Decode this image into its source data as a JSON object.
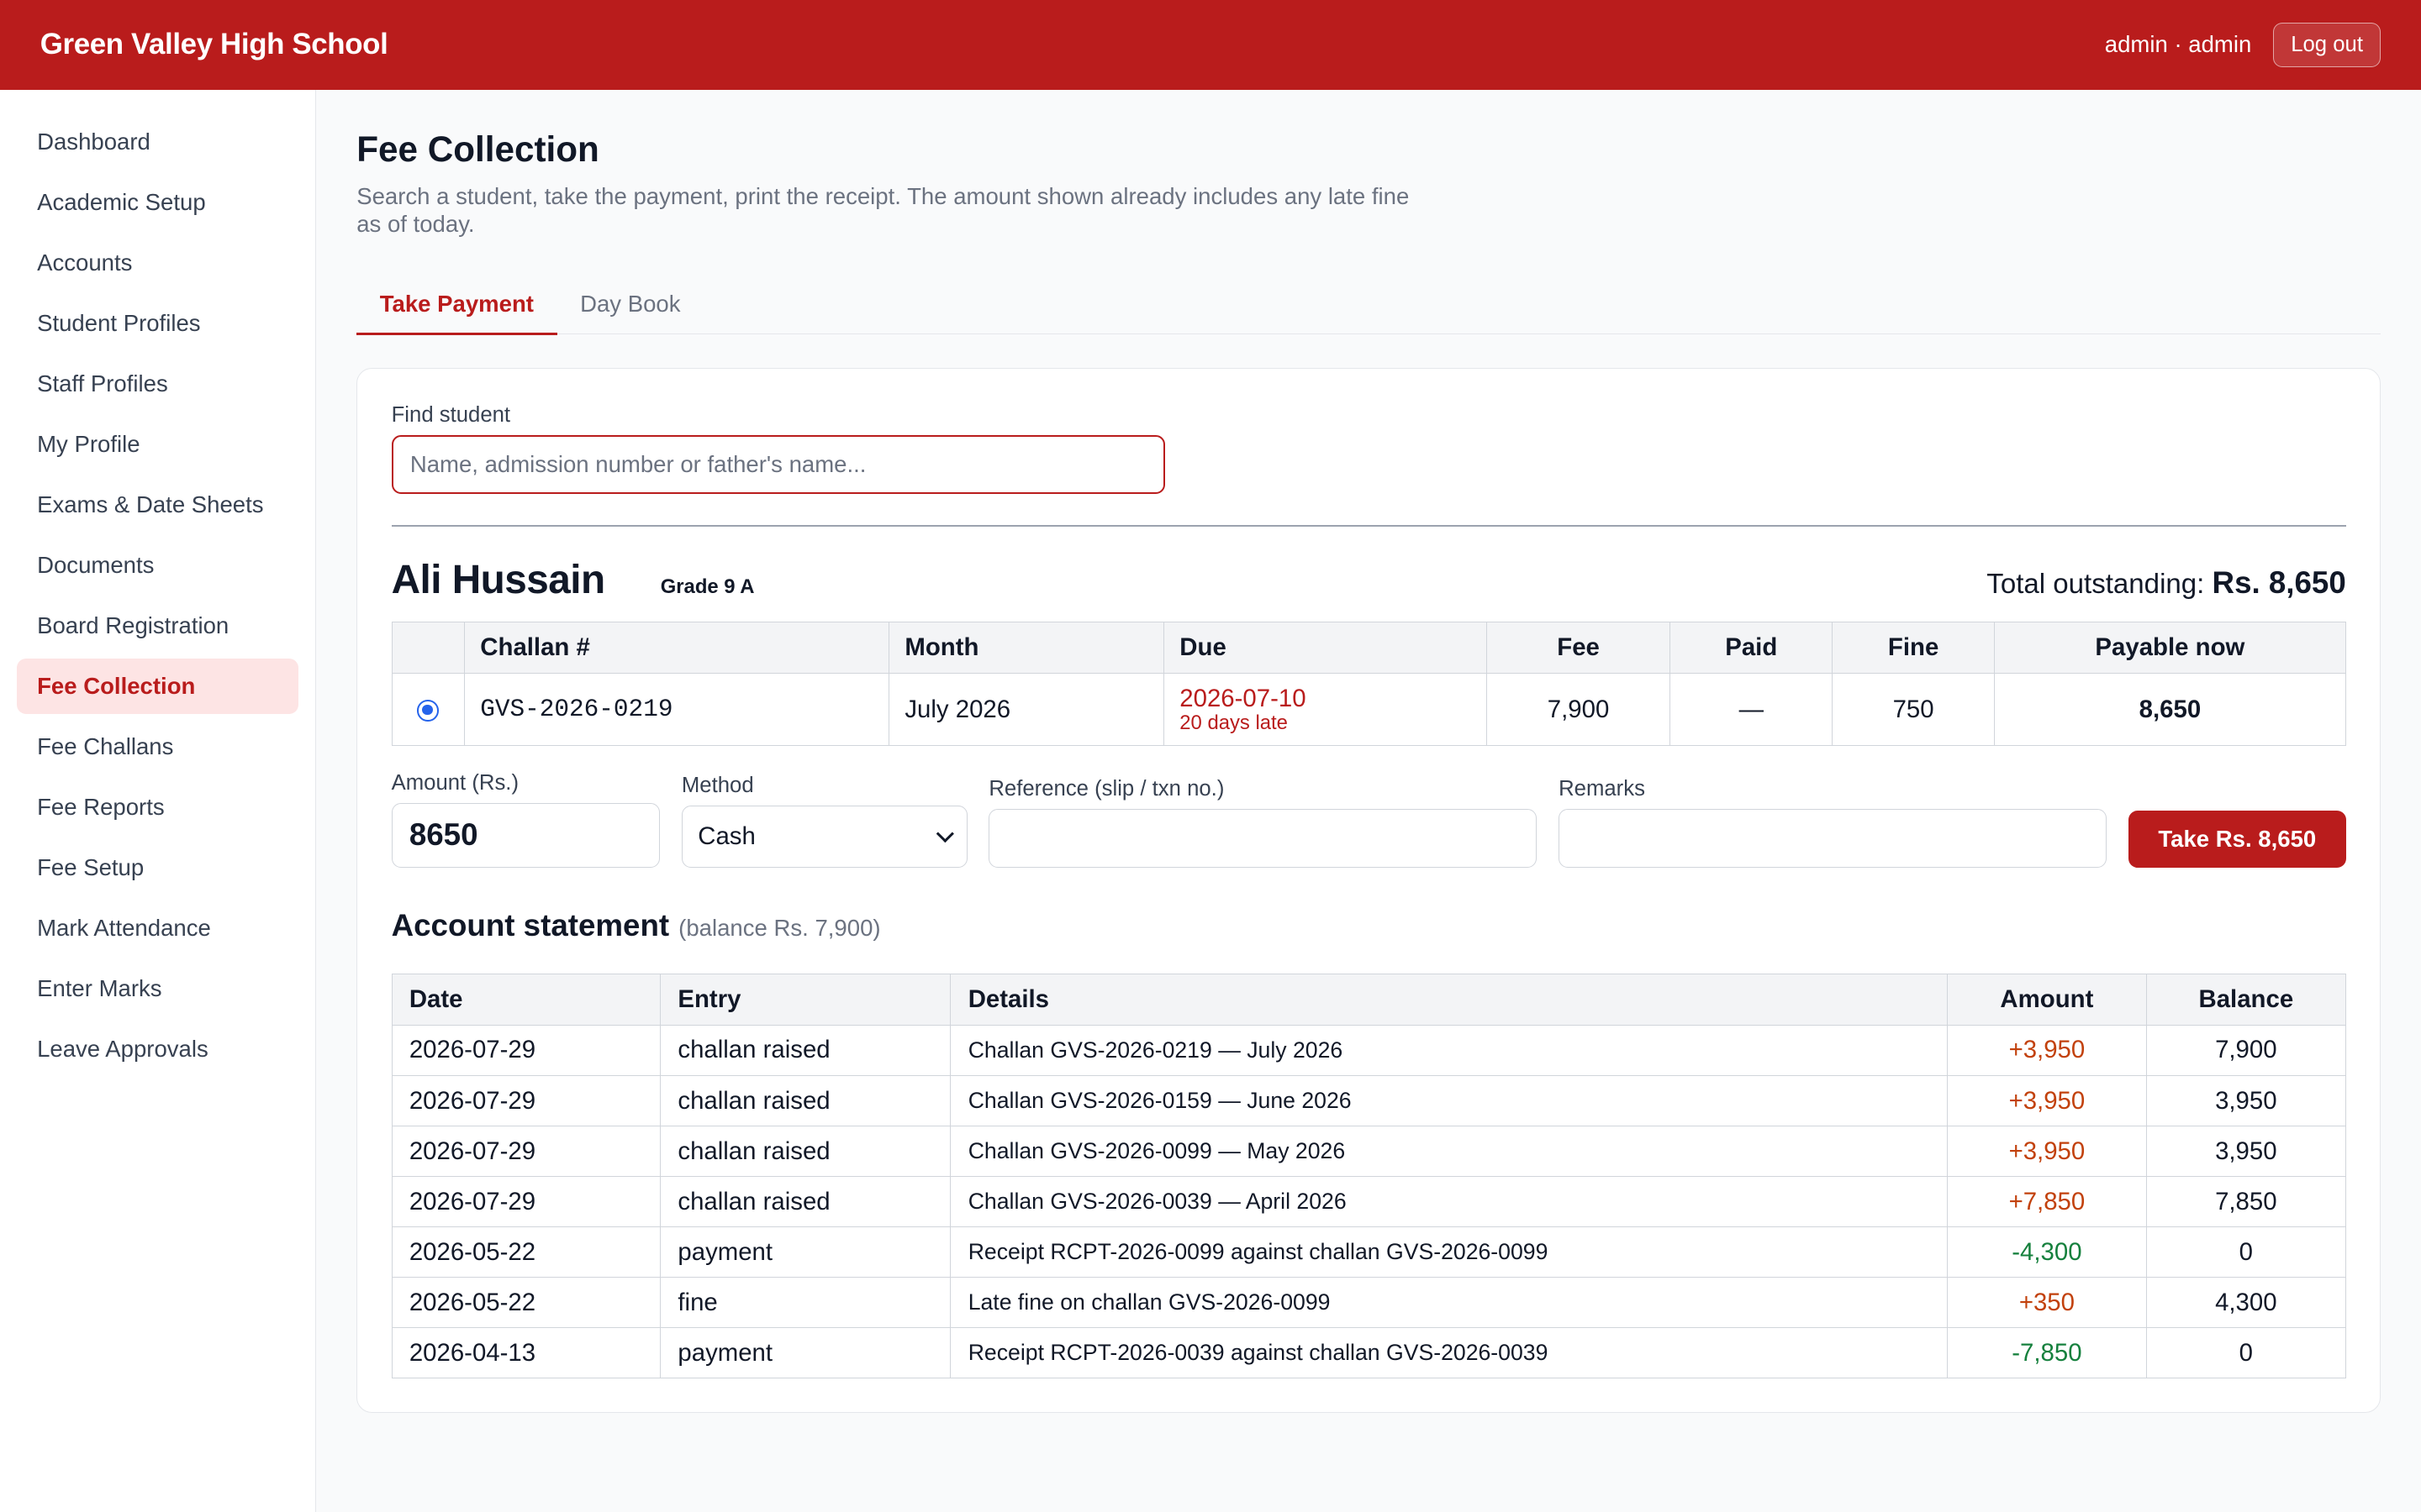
{
  "header": {
    "brand": "Green Valley High School",
    "user": "admin · admin",
    "logout_label": "Log out"
  },
  "sidebar": {
    "items": [
      {
        "label": "Dashboard",
        "active": false
      },
      {
        "label": "Academic Setup",
        "active": false
      },
      {
        "label": "Accounts",
        "active": false
      },
      {
        "label": "Student Profiles",
        "active": false
      },
      {
        "label": "Staff Profiles",
        "active": false
      },
      {
        "label": "My Profile",
        "active": false
      },
      {
        "label": "Exams & Date Sheets",
        "active": false
      },
      {
        "label": "Documents",
        "active": false
      },
      {
        "label": "Board Registration",
        "active": false
      },
      {
        "label": "Fee Collection",
        "active": true
      },
      {
        "label": "Fee Challans",
        "active": false
      },
      {
        "label": "Fee Reports",
        "active": false
      },
      {
        "label": "Fee Setup",
        "active": false
      },
      {
        "label": "Mark Attendance",
        "active": false
      },
      {
        "label": "Enter Marks",
        "active": false
      },
      {
        "label": "Leave Approvals",
        "active": false
      }
    ]
  },
  "page": {
    "title": "Fee Collection",
    "description": "Search a student, take the payment, print the receipt. The amount shown already includes any late fine as of today."
  },
  "tabs": [
    {
      "label": "Take Payment",
      "active": true
    },
    {
      "label": "Day Book",
      "active": false
    }
  ],
  "search": {
    "label": "Find student",
    "placeholder": "Name, admission number or father's name...",
    "value": ""
  },
  "student": {
    "name": "Ali Hussain",
    "grade": "Grade 9 A",
    "outstanding_label": "Total outstanding:",
    "outstanding_value": "Rs. 8,650"
  },
  "challan_table": {
    "headers": {
      "select": "",
      "challan": "Challan #",
      "month": "Month",
      "due": "Due",
      "fee": "Fee",
      "paid": "Paid",
      "fine": "Fine",
      "payable": "Payable now"
    },
    "rows": [
      {
        "selected": true,
        "challan": "GVS-2026-0219",
        "month": "July 2026",
        "due_date": "2026-07-10",
        "due_note": "20 days late",
        "fee": "7,900",
        "paid": "—",
        "fine": "750",
        "payable": "8,650"
      }
    ]
  },
  "payment_form": {
    "amount_label": "Amount (Rs.)",
    "amount_value": "8650",
    "method_label": "Method",
    "method_value": "Cash",
    "reference_label": "Reference (slip / txn no.)",
    "reference_value": "",
    "remarks_label": "Remarks",
    "remarks_value": "",
    "submit_label": "Take Rs. 8,650"
  },
  "statement": {
    "title": "Account statement",
    "balance_note": "(balance Rs. 7,900)",
    "headers": {
      "date": "Date",
      "entry": "Entry",
      "details": "Details",
      "amount": "Amount",
      "balance": "Balance"
    },
    "rows": [
      {
        "date": "2026-07-29",
        "entry": "challan raised",
        "details": "Challan GVS-2026-0219 — July 2026",
        "amount": "+3,950",
        "balance": "7,900",
        "sign": "pos"
      },
      {
        "date": "2026-07-29",
        "entry": "challan raised",
        "details": "Challan GVS-2026-0159 — June 2026",
        "amount": "+3,950",
        "balance": "3,950",
        "sign": "pos"
      },
      {
        "date": "2026-07-29",
        "entry": "challan raised",
        "details": "Challan GVS-2026-0099 — May 2026",
        "amount": "+3,950",
        "balance": "3,950",
        "sign": "pos"
      },
      {
        "date": "2026-07-29",
        "entry": "challan raised",
        "details": "Challan GVS-2026-0039 — April 2026",
        "amount": "+7,850",
        "balance": "7,850",
        "sign": "pos"
      },
      {
        "date": "2026-05-22",
        "entry": "payment",
        "details": "Receipt RCPT-2026-0099 against challan GVS-2026-0099",
        "amount": "-4,300",
        "balance": "0",
        "sign": "neg"
      },
      {
        "date": "2026-05-22",
        "entry": "fine",
        "details": "Late fine on challan GVS-2026-0099",
        "amount": "+350",
        "balance": "4,300",
        "sign": "pos"
      },
      {
        "date": "2026-04-13",
        "entry": "payment",
        "details": "Receipt RCPT-2026-0039 against challan GVS-2026-0039",
        "amount": "-7,850",
        "balance": "0",
        "sign": "neg"
      }
    ]
  },
  "colors": {
    "brand": "#b91c1c",
    "active_nav_bg": "#fde4e4",
    "positive_amount": "#c2410c",
    "negative_amount": "#15803d",
    "radio": "#2563eb"
  }
}
